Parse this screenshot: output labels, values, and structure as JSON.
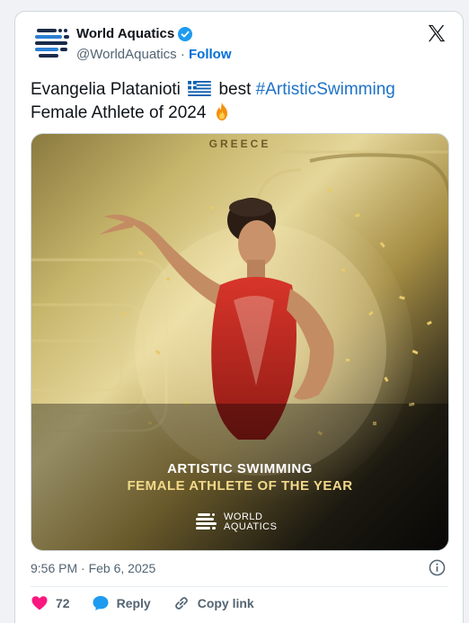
{
  "account": {
    "name": "World Aquatics",
    "handle": "@WorldAquatics",
    "separator": " · ",
    "follow_label": "Follow"
  },
  "tweet": {
    "text_before_flag": "Evangelia Platanioti",
    "text_after_flag": " best ",
    "hashtag": "#ArtisticSwimming",
    "text_line2": "Female Athlete of 2024"
  },
  "media": {
    "country_label": "GREECE",
    "award_line1": "ARTISTIC SWIMMING",
    "award_line2": "FEMALE ATHLETE OF THE YEAR",
    "brand_line1": "WORLD",
    "brand_line2": "AQUATICS"
  },
  "footer": {
    "timestamp": "9:56 PM · Feb 6, 2025"
  },
  "actions": {
    "likes_count": "72",
    "reply_label": "Reply",
    "copy_link_label": "Copy link"
  },
  "icons": {
    "verified": "verified-badge-icon",
    "x_logo": "x-logo-icon",
    "info": "info-icon",
    "like": "heart-icon",
    "reply": "reply-bubble-icon",
    "copy": "link-icon"
  },
  "colors": {
    "link": "#1d72c8",
    "follow": "#006fd6",
    "like": "#f91880",
    "reply": "#1d9bf0",
    "award_gold": "#f2d98a"
  }
}
